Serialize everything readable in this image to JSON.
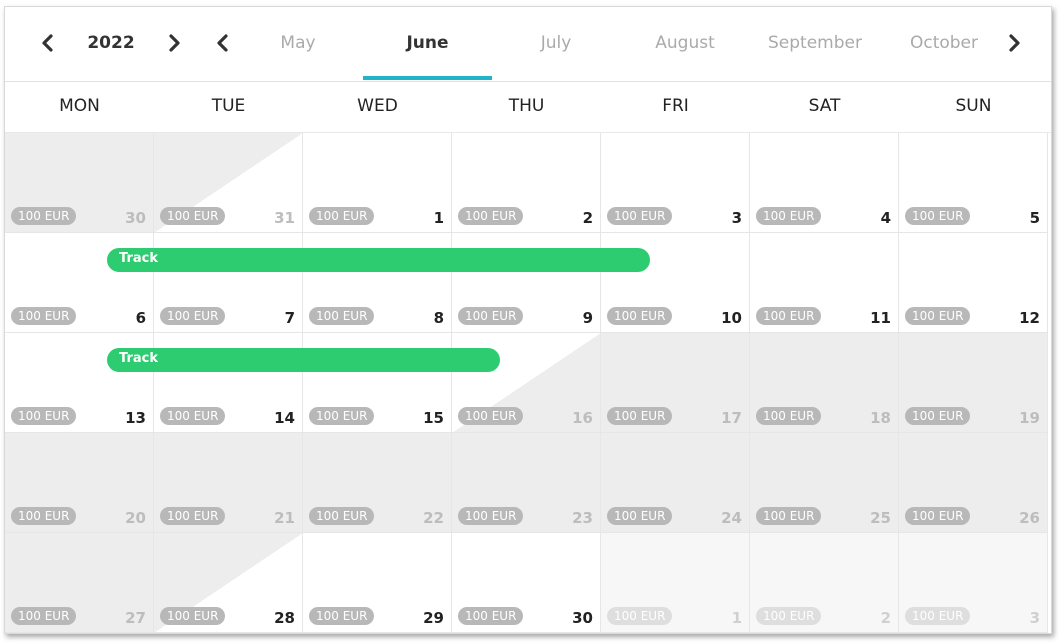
{
  "header": {
    "year": "2022",
    "months": [
      "May",
      "June",
      "July",
      "August",
      "September",
      "October"
    ],
    "active_month": "June"
  },
  "weekdays": [
    "MON",
    "TUE",
    "WED",
    "THU",
    "FRI",
    "SAT",
    "SUN"
  ],
  "price_label": "100 EUR",
  "days": [
    "30",
    "31",
    "1",
    "2",
    "3",
    "4",
    "5",
    "6",
    "7",
    "8",
    "9",
    "10",
    "11",
    "12",
    "13",
    "14",
    "15",
    "16",
    "17",
    "18",
    "19",
    "20",
    "21",
    "22",
    "23",
    "24",
    "25",
    "26",
    "27",
    "28",
    "29",
    "30",
    "1",
    "2",
    "3"
  ],
  "events": [
    {
      "label": "Track"
    },
    {
      "label": "Track"
    }
  ],
  "colors": {
    "accent_underline": "#21b3c9",
    "event_green": "#2ecc71",
    "price_badge": "#b8b8b8",
    "unavailable_cell": "#ededed"
  }
}
